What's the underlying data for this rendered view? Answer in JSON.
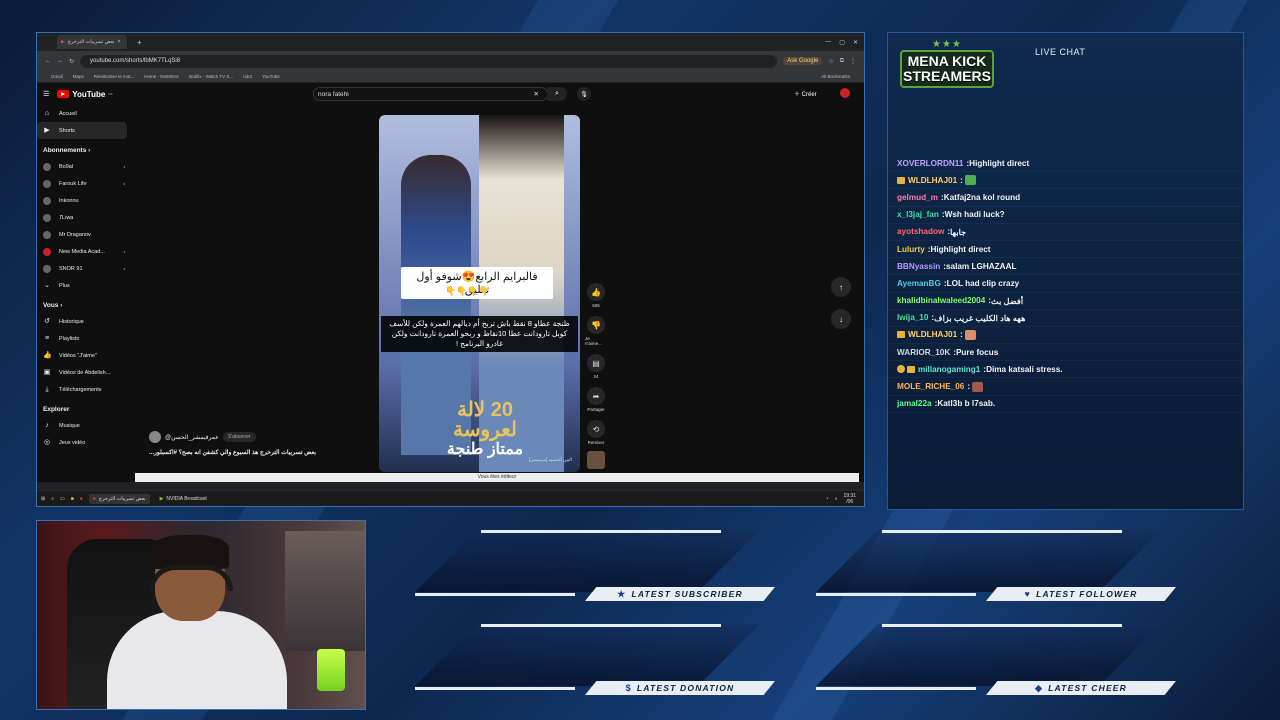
{
  "browser": {
    "tab_title": "بعض تسريبات الترخرج",
    "url": "youtube.com/shorts/lbMK7TLqSi8",
    "ask_label": "Ask Google",
    "bookmarks": [
      "Gmail",
      "Maps",
      "Réinitialiser le mot...",
      "Home - NetMirror",
      "Brafilx - Watch TV S...",
      "ridr2",
      "YouTube"
    ],
    "all_bookmarks": "All Bookmarks"
  },
  "youtube": {
    "logo": "YouTube",
    "region": "MA",
    "search_value": "nora fatehi",
    "create_label": "Créer",
    "sidebar": {
      "main": [
        {
          "label": "Accueil",
          "icon": "⌂"
        },
        {
          "label": "Shorts",
          "icon": "▶"
        }
      ],
      "subs_header": "Abonnements",
      "subs": [
        "Bo9al",
        "Farouk Life",
        "Inkonnu",
        "7Liwa",
        "Mr Draganov",
        "New Media Acad...",
        "SNOR 91",
        "Plus"
      ],
      "you_header": "Vous",
      "you": [
        "Historique",
        "Playlists",
        "Vidéos \"J'aime\"",
        "Vidéos de Abdelish...",
        "Téléchargements"
      ],
      "explore_header": "Explorer",
      "explore": [
        "Musique",
        "Jeux vidéo"
      ]
    },
    "short": {
      "caption1": "فالبرايم الرابع😍شوفو أول تعليق",
      "caption1_emoji": "👇👇👇👇",
      "caption2": "طنجة عطاو 8 نقط باش تربح أم ديالهم العمرة ولكن للأسف كوبل تارودانت عطا 10نقاط و ربحو العمرة تارودانت ولكن غادرو البرنامج !",
      "gold_text": "20 لالة لعروسة",
      "gold_sub": "ممتاز طنجة",
      "channel": "البين الحسيه [مرسيس]"
    },
    "actions": {
      "likes": "505",
      "dislike": "Je n'aime...",
      "comments": "24",
      "share": "Partager",
      "remix": "Remixer"
    },
    "meta": {
      "channel": "@عمرقيمشر_الحسن",
      "subscribe": "S'abonner",
      "title": "بعض تسريبات الترخرج هذ السبوع والي كشفن انه بصح؟ #اكسبلور..."
    },
    "notice": "Vous êtes éditeur"
  },
  "taskbar": {
    "app1": "بعض تسريبات الترخرج",
    "app2": "NVIDIA Broadcast",
    "time": "19:31",
    "date": "/06"
  },
  "chat": {
    "logo_lines": [
      "MENA KICK",
      "STREAMERS"
    ],
    "title": "LIVE CHAT",
    "messages": [
      {
        "user": "XOVERLORDN11",
        "text": "Highlight direct",
        "color": "#c2a3ff"
      },
      {
        "user": "WLDLHAJ01",
        "text": "",
        "color": "#ffd166",
        "badge": true,
        "emote": "#4caf50"
      },
      {
        "user": "gelmud_m",
        "text": "Katfaj2na kol round",
        "color": "#ff7aa8"
      },
      {
        "user": "x_l3jaj_fan",
        "text": "Wsh hadi luck?",
        "color": "#47e0a0"
      },
      {
        "user": "ayotshadow",
        "text": "جابها",
        "color": "#ff6b6b"
      },
      {
        "user": "Lulurty",
        "text": "Highlight direct",
        "color": "#f7c948"
      },
      {
        "user": "BBNyassin",
        "text": "salam LGHAZAAL",
        "color": "#b89bff"
      },
      {
        "user": "AyemanBG",
        "text": "LOL had clip crazy",
        "color": "#4dd0e1"
      },
      {
        "user": "khalidbinalwaleed2004",
        "text": "أفضل بث",
        "color": "#7cff6b"
      },
      {
        "user": "lwija_10",
        "text": "ههه هاد الكليب غريب بزاف",
        "color": "#47e0a0"
      },
      {
        "user": "WLDLHAJ01",
        "text": "",
        "color": "#ffd166",
        "badge": true,
        "emote": "#e08a6a"
      },
      {
        "user": "WARIOR_10K",
        "text": "Pure focus",
        "color": "#d0d6e0"
      },
      {
        "user": "millanogaming1",
        "text": "Dima katsali stress.",
        "color": "#5fe3d0",
        "badge2": true
      },
      {
        "user": "MOLE_RICHE_06",
        "text": "",
        "color": "#ffb454",
        "emote": "#a05a4a"
      },
      {
        "user": "jamal22a",
        "text": "Katl3b b l7sab.",
        "color": "#5cff8a"
      }
    ]
  },
  "panels": {
    "subscriber": {
      "label": "LATEST SUBSCRIBER",
      "icon": "★"
    },
    "follower": {
      "label": "LATEST FOLLOWER",
      "icon": "♥"
    },
    "donation": {
      "label": "LATEST DONATION",
      "icon": "$"
    },
    "cheer": {
      "label": "LATEST CHEER",
      "icon": "◆"
    }
  }
}
